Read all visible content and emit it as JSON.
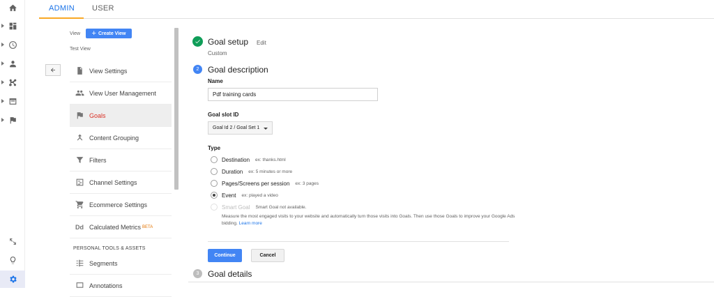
{
  "tabs": [
    {
      "label": "ADMIN"
    },
    {
      "label": "USER"
    }
  ],
  "rail": {
    "icons": [
      "home-icon",
      "dashboard-icon",
      "clock-icon",
      "person-icon",
      "acquisition-icon",
      "behavior-icon",
      "flag-icon",
      "share-icon",
      "lightbulb-icon",
      "gear-icon"
    ]
  },
  "view_column": {
    "view_label": "View",
    "create_view_label": "Create View",
    "current_view": "Test View",
    "items": [
      {
        "label": "View Settings",
        "icon": "document-icon"
      },
      {
        "label": "View User Management",
        "icon": "people-icon"
      },
      {
        "label": "Goals",
        "icon": "flag-icon"
      },
      {
        "label": "Content Grouping",
        "icon": "grouping-icon"
      },
      {
        "label": "Filters",
        "icon": "filter-icon"
      },
      {
        "label": "Channel Settings",
        "icon": "channel-icon"
      },
      {
        "label": "Ecommerce Settings",
        "icon": "cart-icon"
      },
      {
        "label": "Calculated Metrics",
        "icon": "dd-icon",
        "badge": "BETA"
      }
    ],
    "section_title": "PERSONAL TOOLS & ASSETS",
    "tools": [
      {
        "label": "Segments",
        "icon": "segments-icon"
      },
      {
        "label": "Annotations",
        "icon": "annotations-icon"
      }
    ]
  },
  "goal_setup": {
    "title": "Goal setup",
    "edit_label": "Edit",
    "value": "Custom"
  },
  "goal_description": {
    "step": "2",
    "title": "Goal description",
    "name_label": "Name",
    "name_value": "Pdf training cards",
    "slot_label": "Goal slot ID",
    "slot_value": "Goal Id 2 / Goal Set 1",
    "type_label": "Type",
    "types": [
      {
        "label": "Destination",
        "hint": "ex: thanks.html",
        "checked": false
      },
      {
        "label": "Duration",
        "hint": "ex: 5 minutes or more",
        "checked": false
      },
      {
        "label": "Pages/Screens per session",
        "hint": "ex: 3 pages",
        "checked": false
      },
      {
        "label": "Event",
        "hint": "ex: played a video",
        "checked": true
      },
      {
        "label": "Smart Goal",
        "hint": "Smart Goal not available.",
        "checked": false,
        "disabled": true
      }
    ],
    "smart_goal_desc": "Measure the most engaged visits to your website and automatically turn those visits into Goals. Then use those Goals to improve your Google Ads bidding.",
    "learn_more": "Learn more",
    "continue_label": "Continue",
    "cancel_label": "Cancel"
  },
  "goal_details": {
    "step": "3",
    "title": "Goal details"
  },
  "colors": {
    "accent": "#1a73e8",
    "button_blue": "#4285f4",
    "success": "#0f9d58",
    "active_red": "#d93025",
    "tab_underline": "#f9a825"
  }
}
